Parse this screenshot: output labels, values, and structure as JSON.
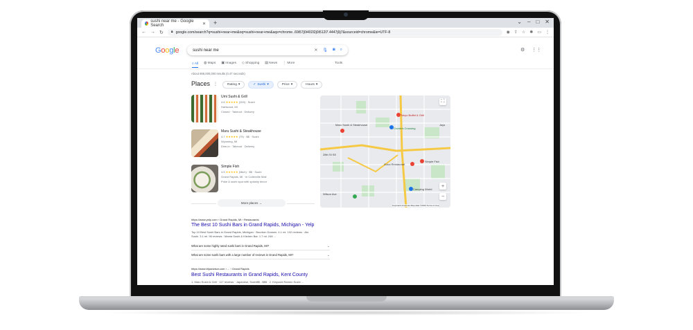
{
  "browser": {
    "tab_title": "sushi near me - Google Search",
    "new_tab": "+",
    "url": "google.com/search?q=sushi+near+me&oq=sushi+near+me&aqs=chrome..69i57j0i402l2j0i512l7.4447j0j7&sourceid=chrome&ie=UTF-8"
  },
  "google": {
    "logo": [
      "G",
      "o",
      "o",
      "g",
      "l",
      "e"
    ],
    "query": "sushi near me",
    "tabs": [
      "All",
      "Maps",
      "Images",
      "Shopping",
      "News",
      "More"
    ],
    "tools": "Tools",
    "about": "About 696,000,000 results (0.47 seconds)"
  },
  "places": {
    "title": "Places",
    "chips": [
      "Rating",
      "Sushi",
      "Price",
      "Hours"
    ],
    "items": [
      {
        "name": "Umi Sushi & Grill",
        "rating": "4.6",
        "stars": "★★★★★",
        "meta": "(209) · Sushi",
        "loc": "Hartwood, MI",
        "extra": "Closed · Takeout · Delivery"
      },
      {
        "name": "Maru Sushi & Steakhouse",
        "rating": "4.7",
        "stars": "★★★★★",
        "meta": "(79) · $$ · Sushi",
        "loc": "Wyoming, MI",
        "extra": "Dine-in · Takeout · Delivery"
      },
      {
        "name": "Simple Fish",
        "rating": "4.5",
        "stars": "★★★★★",
        "meta": "(Mich) · $$ · Sushi",
        "loc": "Grand Rapids, MI · In Cutlerville Mall",
        "extra": "Poke & sushi spot with splashy decor"
      }
    ],
    "more_places": "More places →"
  },
  "map": {
    "labels": {
      "tokyo": "Tokyo Buffet & Grill",
      "maru": "Maru Sushi & Steakhouse",
      "umi": "Umi Sushi & Grill",
      "simple": "Simple Fish",
      "camping": "Camping World",
      "ooka": "Ooka Restaurant",
      "jay": "Jays",
      "crossing": "Cronin's Crossing",
      "road1": "28th St SE",
      "road2": "Wilson Ave"
    },
    "zoom_in": "+",
    "zoom_out": "−",
    "attribution": "Keyboard shortcuts   Map data ©2023   Terms of Use"
  },
  "results": [
    {
      "url": "https://www.yelp.com › Grand Rapids, MI › Restaurants",
      "title": "The Best 10 Sushi Bars in Grand Rapids, Michigan - Yelp",
      "snippet": "Top 10 Best Sushi Bars in Grand Rapids, Michigan · Bourbon Dossen, 4.1 mi. 102 reviews · Ato",
      "snippet2": "Sushi. 3.1 mi. 96 reviews · Mama Sushi & Kitchen Bar. 1.7 mi. 248 ..."
    },
    {
      "url": "https://www.tripadvisor.com › ... › Grand Rapids",
      "title": "Best Sushi Restaurants in Grand Rapids, Kent County",
      "snippet": "1. Maru Sushi & Grill · 117 reviews · Japanese, Sushi$$ - $$$ · 2. Kinyoubi Ramen Sushi ..."
    }
  ],
  "faqs": [
    "What are some highly rated sushi bars in Grand Rapids, MI?",
    "What are some sushi bars with a large number of reviews in Grand Rapids, MI?"
  ]
}
